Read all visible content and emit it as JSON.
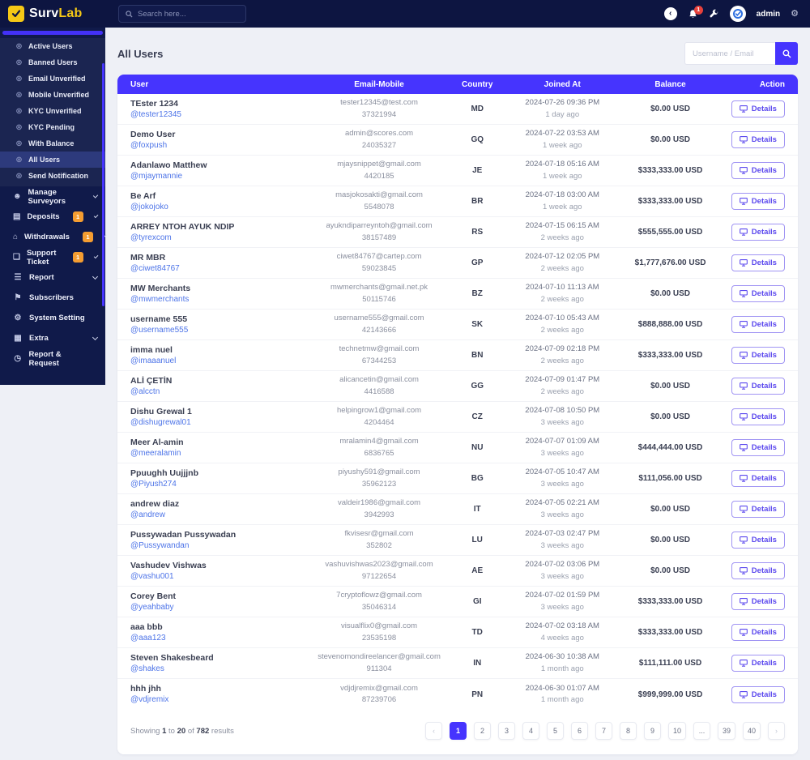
{
  "topbar": {
    "logo_primary": "Surv",
    "logo_secondary": "Lab",
    "search_placeholder": "Search here...",
    "notification_count": "1",
    "admin_label": "admin"
  },
  "sidebar": {
    "submenu_items": [
      {
        "label": "Active Users",
        "active": false
      },
      {
        "label": "Banned Users",
        "active": false
      },
      {
        "label": "Email Unverified",
        "active": false
      },
      {
        "label": "Mobile Unverified",
        "active": false
      },
      {
        "label": "KYC Unverified",
        "active": false
      },
      {
        "label": "KYC Pending",
        "active": false
      },
      {
        "label": "With Balance",
        "active": false
      },
      {
        "label": "All Users",
        "active": true
      },
      {
        "label": "Send Notification",
        "active": false
      }
    ],
    "items": [
      {
        "label": "Manage Surveyors",
        "icon": "users-icon",
        "badge": null,
        "chevron": true
      },
      {
        "label": "Deposits",
        "icon": "file-invoice-icon",
        "badge": "1",
        "chevron": true
      },
      {
        "label": "Withdrawals",
        "icon": "bank-icon",
        "badge": "1",
        "chevron": true
      },
      {
        "label": "Support Ticket",
        "icon": "ticket-icon",
        "badge": "1",
        "chevron": true
      },
      {
        "label": "Report",
        "icon": "report-icon",
        "badge": null,
        "chevron": true
      },
      {
        "label": "Subscribers",
        "icon": "subscribers-icon",
        "badge": null,
        "chevron": false
      },
      {
        "label": "System Setting",
        "icon": "gear-icon",
        "badge": null,
        "chevron": false
      },
      {
        "label": "Extra",
        "icon": "extra-icon",
        "badge": null,
        "chevron": true
      },
      {
        "label": "Report & Request",
        "icon": "clock-icon",
        "badge": null,
        "chevron": false
      }
    ]
  },
  "page": {
    "title": "All Users"
  },
  "filter": {
    "search_placeholder": "Username / Email"
  },
  "table": {
    "headers": [
      "User",
      "Email-Mobile",
      "Country",
      "Joined At",
      "Balance",
      "Action"
    ],
    "action_label": "Details",
    "rows": [
      {
        "name": "TEster 1234",
        "handle": "@tester12345",
        "email": "tester12345@test.com",
        "mobile": "37321994",
        "country": "MD",
        "joined": "2024-07-26 09:36 PM",
        "ago": "1 day ago",
        "balance": "$0.00 USD"
      },
      {
        "name": "Demo User",
        "handle": "@foxpush",
        "email": "admin@scores.com",
        "mobile": "24035327",
        "country": "GQ",
        "joined": "2024-07-22 03:53 AM",
        "ago": "1 week ago",
        "balance": "$0.00 USD"
      },
      {
        "name": "Adanlawo Matthew",
        "handle": "@mjaymannie",
        "email": "mjaysnippet@gmail.com",
        "mobile": "4420185",
        "country": "JE",
        "joined": "2024-07-18 05:16 AM",
        "ago": "1 week ago",
        "balance": "$333,333.00 USD"
      },
      {
        "name": "Be Arf",
        "handle": "@jokojoko",
        "email": "masjokosakti@gmail.com",
        "mobile": "5548078",
        "country": "BR",
        "joined": "2024-07-18 03:00 AM",
        "ago": "1 week ago",
        "balance": "$333,333.00 USD"
      },
      {
        "name": "ARREY NTOH AYUK NDIP",
        "handle": "@tyrexcom",
        "email": "ayukndiparreyntoh@gmail.com",
        "mobile": "38157489",
        "country": "RS",
        "joined": "2024-07-15 06:15 AM",
        "ago": "2 weeks ago",
        "balance": "$555,555.00 USD"
      },
      {
        "name": "MR MBR",
        "handle": "@ciwet84767",
        "email": "ciwet84767@cartep.com",
        "mobile": "59023845",
        "country": "GP",
        "joined": "2024-07-12 02:05 PM",
        "ago": "2 weeks ago",
        "balance": "$1,777,676.00 USD"
      },
      {
        "name": "MW Merchants",
        "handle": "@mwmerchants",
        "email": "mwmerchants@gmail.net.pk",
        "mobile": "50115746",
        "country": "BZ",
        "joined": "2024-07-10 11:13 AM",
        "ago": "2 weeks ago",
        "balance": "$0.00 USD"
      },
      {
        "name": "username 555",
        "handle": "@username555",
        "email": "username555@gmail.com",
        "mobile": "42143666",
        "country": "SK",
        "joined": "2024-07-10 05:43 AM",
        "ago": "2 weeks ago",
        "balance": "$888,888.00 USD"
      },
      {
        "name": "imma nuel",
        "handle": "@imaaanuel",
        "email": "technetmw@gmail.com",
        "mobile": "67344253",
        "country": "BN",
        "joined": "2024-07-09 02:18 PM",
        "ago": "2 weeks ago",
        "balance": "$333,333.00 USD"
      },
      {
        "name": "ALİ ÇETİN",
        "handle": "@alcctn",
        "email": "alicancetin@gmail.com",
        "mobile": "4416588",
        "country": "GG",
        "joined": "2024-07-09 01:47 PM",
        "ago": "2 weeks ago",
        "balance": "$0.00 USD"
      },
      {
        "name": "Dishu Grewal 1",
        "handle": "@dishugrewal01",
        "email": "helpingrow1@gmail.com",
        "mobile": "4204464",
        "country": "CZ",
        "joined": "2024-07-08 10:50 PM",
        "ago": "3 weeks ago",
        "balance": "$0.00 USD"
      },
      {
        "name": "Meer Al-amin",
        "handle": "@meeralamin",
        "email": "mralamin4@gmail.com",
        "mobile": "6836765",
        "country": "NU",
        "joined": "2024-07-07 01:09 AM",
        "ago": "3 weeks ago",
        "balance": "$444,444.00 USD"
      },
      {
        "name": "Ppuughh Uujjjnb",
        "handle": "@Piyush274",
        "email": "piyushy591@gmail.com",
        "mobile": "35962123",
        "country": "BG",
        "joined": "2024-07-05 10:47 AM",
        "ago": "3 weeks ago",
        "balance": "$111,056.00 USD"
      },
      {
        "name": "andrew diaz",
        "handle": "@andrew",
        "email": "valdeir1986@gmail.com",
        "mobile": "3942993",
        "country": "IT",
        "joined": "2024-07-05 02:21 AM",
        "ago": "3 weeks ago",
        "balance": "$0.00 USD"
      },
      {
        "name": "Pussywadan Pussywadan",
        "handle": "@Pussywandan",
        "email": "fkvisesr@gmail.com",
        "mobile": "352802",
        "country": "LU",
        "joined": "2024-07-03 02:47 PM",
        "ago": "3 weeks ago",
        "balance": "$0.00 USD"
      },
      {
        "name": "Vashudev Vishwas",
        "handle": "@vashu001",
        "email": "vashuvishwas2023@gmail.com",
        "mobile": "97122654",
        "country": "AE",
        "joined": "2024-07-02 03:06 PM",
        "ago": "3 weeks ago",
        "balance": "$0.00 USD"
      },
      {
        "name": "Corey Bent",
        "handle": "@yeahbaby",
        "email": "7cryptoflowz@gmail.com",
        "mobile": "35046314",
        "country": "GI",
        "joined": "2024-07-02 01:59 PM",
        "ago": "3 weeks ago",
        "balance": "$333,333.00 USD"
      },
      {
        "name": "aaa bbb",
        "handle": "@aaa123",
        "email": "visualflix0@gmail.com",
        "mobile": "23535198",
        "country": "TD",
        "joined": "2024-07-02 03:18 AM",
        "ago": "4 weeks ago",
        "balance": "$333,333.00 USD"
      },
      {
        "name": "Steven Shakesbeard",
        "handle": "@shakes",
        "email": "stevenomondireelancer@gmail.com",
        "mobile": "911304",
        "country": "IN",
        "joined": "2024-06-30 10:38 AM",
        "ago": "1 month ago",
        "balance": "$111,111.00 USD"
      },
      {
        "name": "hhh jhh",
        "handle": "@vdjremix",
        "email": "vdjdjremix@gmail.com",
        "mobile": "87239706",
        "country": "PN",
        "joined": "2024-06-30 01:07 AM",
        "ago": "1 month ago",
        "balance": "$999,999.00 USD"
      }
    ]
  },
  "pagination": {
    "summary": {
      "pre": "Showing",
      "from": "1",
      "mid": "to",
      "to": "20",
      "of": "of",
      "total": "782",
      "post": "results"
    },
    "prev": "‹",
    "next": "›",
    "pages": [
      "1",
      "2",
      "3",
      "4",
      "5",
      "6",
      "7",
      "8",
      "9",
      "10",
      "...",
      "39",
      "40"
    ],
    "active_page": "1"
  },
  "colors": {
    "accent": "#4634fe",
    "navy_topbar": "#0d1541",
    "navy_sidebar": "#101a4a",
    "submenu_bg": "#1b2551",
    "active_item_bg": "#2d3a7c",
    "logo_yellow": "#f5c816",
    "link_blue": "#4d74e8",
    "badge_orange": "#f59d31",
    "notification_red": "#e8413c",
    "page_bg": "#eef0f6"
  }
}
